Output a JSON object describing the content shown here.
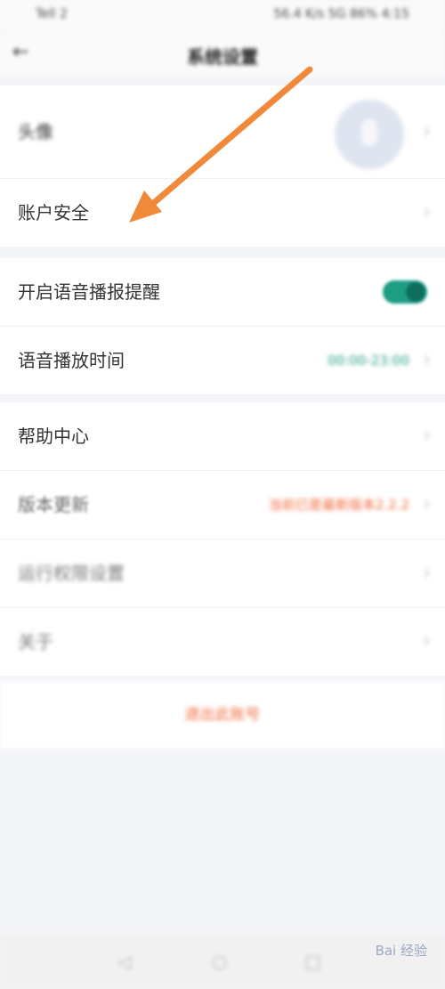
{
  "status": {
    "left": "Tell 2",
    "right": "56.4 K/s 5G 86% 4:15"
  },
  "nav": {
    "back_icon": "arrow-left-icon",
    "title": "系统设置"
  },
  "group1": [
    {
      "label": "头像",
      "type": "avatar"
    },
    {
      "label": "账户安全",
      "type": "chevron"
    }
  ],
  "group2": [
    {
      "label": "开启语音播报提醒",
      "type": "toggle",
      "on": true
    },
    {
      "label": "语音播放时间",
      "value": "00:00-23:00",
      "value_color": "#1e9d85"
    }
  ],
  "group3": [
    {
      "label": "帮助中心"
    },
    {
      "label": "版本更新",
      "value": "当前已是最新版本2.2.2",
      "value_color": "#f06a3b"
    },
    {
      "label": "运行权限设置"
    },
    {
      "label": "关于"
    }
  ],
  "logout_label": "退出此账号",
  "bottom_nav": [
    "◁",
    "○",
    "□"
  ],
  "watermark": "Bai 经验",
  "colors": {
    "accent_green": "#1e9d85",
    "accent_orange": "#f06a3b",
    "arrow": "#f08a3a"
  }
}
